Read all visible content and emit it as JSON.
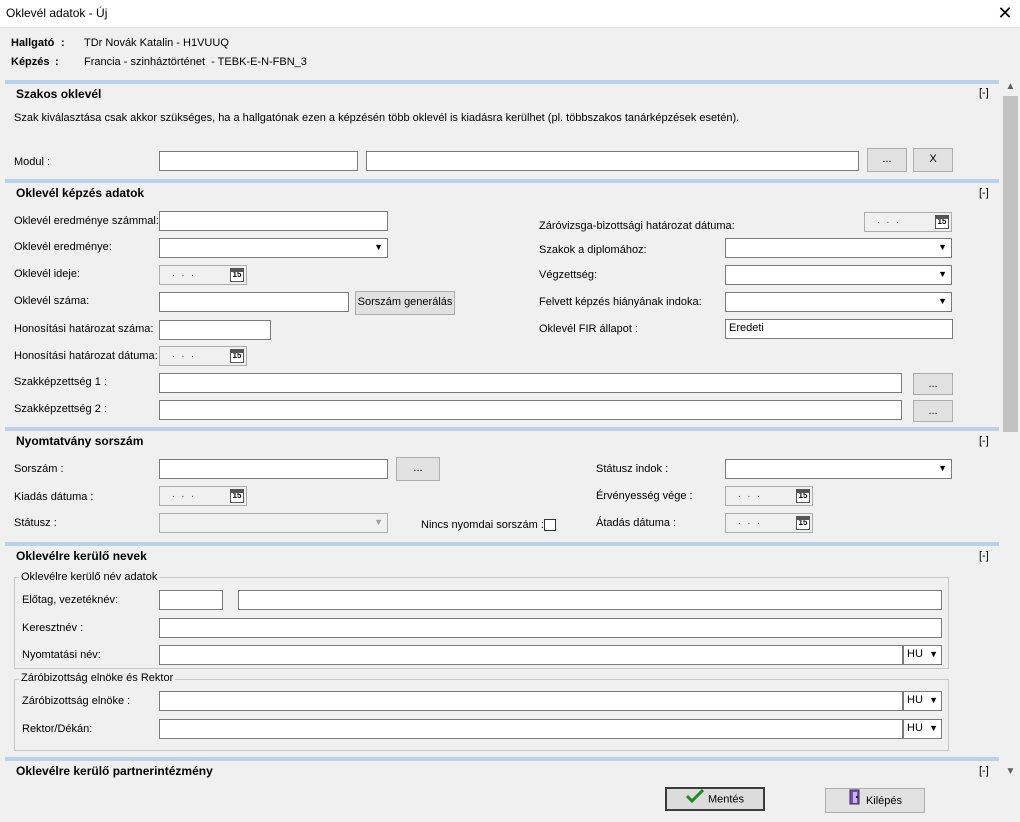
{
  "window": {
    "title": "Oklevél adatok - Új",
    "close": "✕"
  },
  "student": {
    "label": "Hallgató",
    "value": "TDr Novák Katalin - H1VUUQ"
  },
  "training": {
    "label": "Képzés",
    "value": "Francia - szinháztörténet  - TEBK-E-N-FBN_3"
  },
  "colon": ":",
  "collapse_label": "[-]",
  "ellipsis": "...",
  "date_placeholder": ". . .",
  "cal_day": "15",
  "lang_value": "HU",
  "sections": {
    "szakos": {
      "title": "Szakos oklevél",
      "note": "Szak kiválasztása csak akkor szükséges, ha a hallgatónak ezen a képzésén több oklevél is kiadásra kerülhet (pl. többszakos tanárképzések esetén).",
      "modul_label": "Modul :",
      "clear_label": "X"
    },
    "kepzes": {
      "title": "Oklevél képzés adatok",
      "eredmeny_szam": "Oklevél eredménye számmal:",
      "eredmeny": "Oklevél eredménye:",
      "ideje": "Oklevél ideje:",
      "szama": "Oklevél száma:",
      "generate": "Sorszám generálás",
      "honositas_szam": "Honosítási határozat száma:",
      "honositas_datum": "Honosítási határozat dátuma:",
      "szakkepzettseg1": "Szakképzettség 1 :",
      "szakkepzettseg2": "Szakképzettség 2 :",
      "zarovizsga": "Záróvizsga-bizottsági határozat dátuma:",
      "szakok": "Szakok a diplomához:",
      "vegzettseg": "Végzettség:",
      "felvett": "Felvett képzés hiányának indoka:",
      "fir_label": "Oklevél FIR állapot :",
      "fir_value": "Eredeti"
    },
    "nyomtatvany": {
      "title": "Nyomtatvány sorszám",
      "sorszam": "Sorszám :",
      "kiadas": "Kiadás dátuma :",
      "statusz": "Státusz :",
      "nincs": "Nincs nyomdai sorszám :",
      "statusz_indok": "Státusz indok :",
      "ervenyesseg": "Érvényesség vége :",
      "atadas": "Átadás dátuma :"
    },
    "nevek": {
      "title": "Oklevélre kerülő nevek",
      "group1": "Oklevélre kerülő név adatok",
      "elotag": "Előtag, vezetéknév:",
      "keresztnev": "Keresztnév :",
      "nyomtatasi": "Nyomtatási név:",
      "group2": "Záróbizottság elnöke és Rektor",
      "elnok": "Záróbizottság elnöke :",
      "rektor": "Rektor/Dékán:"
    },
    "partner": {
      "title": "Oklevélre kerülő partnerintézmény"
    }
  },
  "footer": {
    "save": "Mentés",
    "exit": "Kilépés"
  },
  "colors": {
    "section_line": "#b9d1ea",
    "save_check": "#1e8c1e"
  }
}
